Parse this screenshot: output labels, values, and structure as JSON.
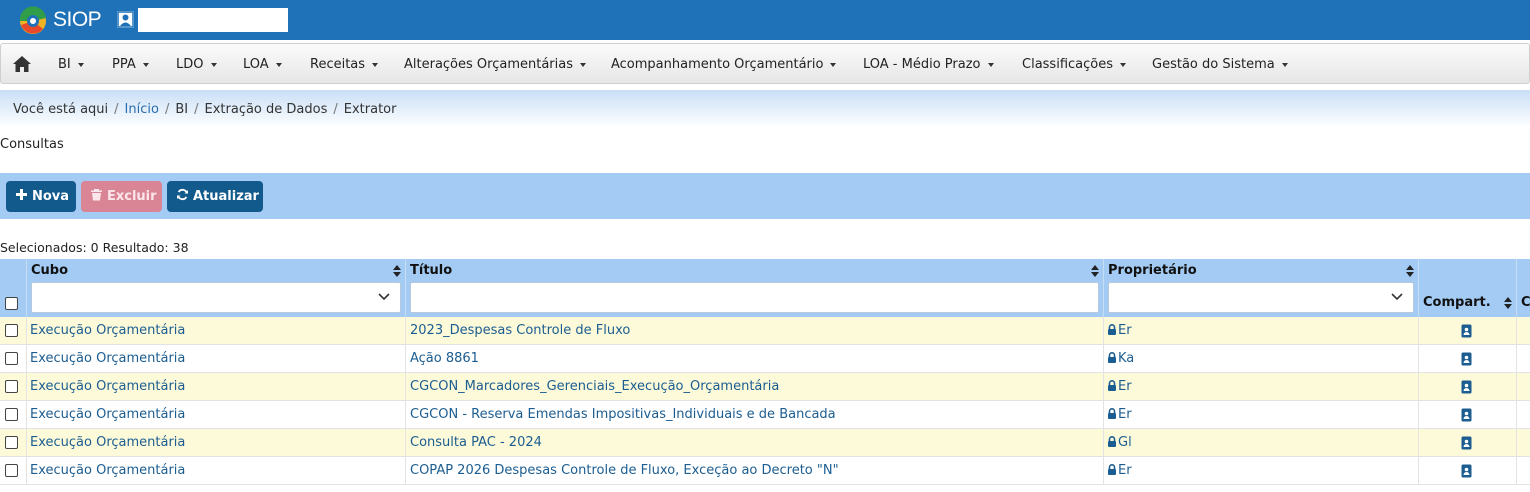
{
  "header": {
    "app_name": "SIOP",
    "user_icon": "user-icon",
    "logo_icon": "siop-logo-icon"
  },
  "menu": {
    "home_icon": "home-icon",
    "items": [
      {
        "label": "BI"
      },
      {
        "label": "PPA"
      },
      {
        "label": "LDO"
      },
      {
        "label": "LOA"
      },
      {
        "label": "Receitas"
      },
      {
        "label": "Alterações Orçamentárias"
      },
      {
        "label": "Acompanhamento Orçamentário"
      },
      {
        "label": "LOA - Médio Prazo"
      },
      {
        "label": "Classificações"
      },
      {
        "label": "Gestão do Sistema"
      }
    ]
  },
  "breadcrumb": {
    "prefix": "Você está aqui",
    "items": [
      "Início",
      "BI",
      "Extração de Dados",
      "Extrator"
    ]
  },
  "section_title": "Consultas",
  "toolbar": {
    "nova_label": "Nova",
    "excluir_label": "Excluir",
    "atualizar_label": "Atualizar"
  },
  "result_info": "Selecionados: 0 Resultado: 38",
  "table": {
    "columns": {
      "cubo": "Cubo",
      "titulo": "Título",
      "proprietario": "Proprietário",
      "compart": "Compart.",
      "next": "C"
    },
    "rows": [
      {
        "cubo": "Execução Orçamentária",
        "titulo": "2023_Despesas Controle de Fluxo",
        "proprietario": "Er"
      },
      {
        "cubo": "Execução Orçamentária",
        "titulo": "Ação 8861",
        "proprietario": "Ka"
      },
      {
        "cubo": "Execução Orçamentária",
        "titulo": "CGCON_Marcadores_Gerenciais_Execução_Orçamentária",
        "proprietario": "Er"
      },
      {
        "cubo": "Execução Orçamentária",
        "titulo": "CGCON - Reserva Emendas Impositivas_Individuais e de Bancada",
        "proprietario": "Er"
      },
      {
        "cubo": "Execução Orçamentária",
        "titulo": "Consulta PAC - 2024",
        "proprietario": "Gl"
      },
      {
        "cubo": "Execução Orçamentária",
        "titulo": "COPAP 2026 Despesas Controle de Fluxo, Exceção ao Decreto \"N\"",
        "proprietario": "Er"
      }
    ]
  },
  "colors": {
    "header_bg": "#1f72b8",
    "toolbar_bg": "#a3cbf4",
    "primary_button": "#135a8c",
    "danger_button_disabled": "#d98595",
    "row_highlight": "#fcfad9",
    "link": "#1c5d91"
  }
}
